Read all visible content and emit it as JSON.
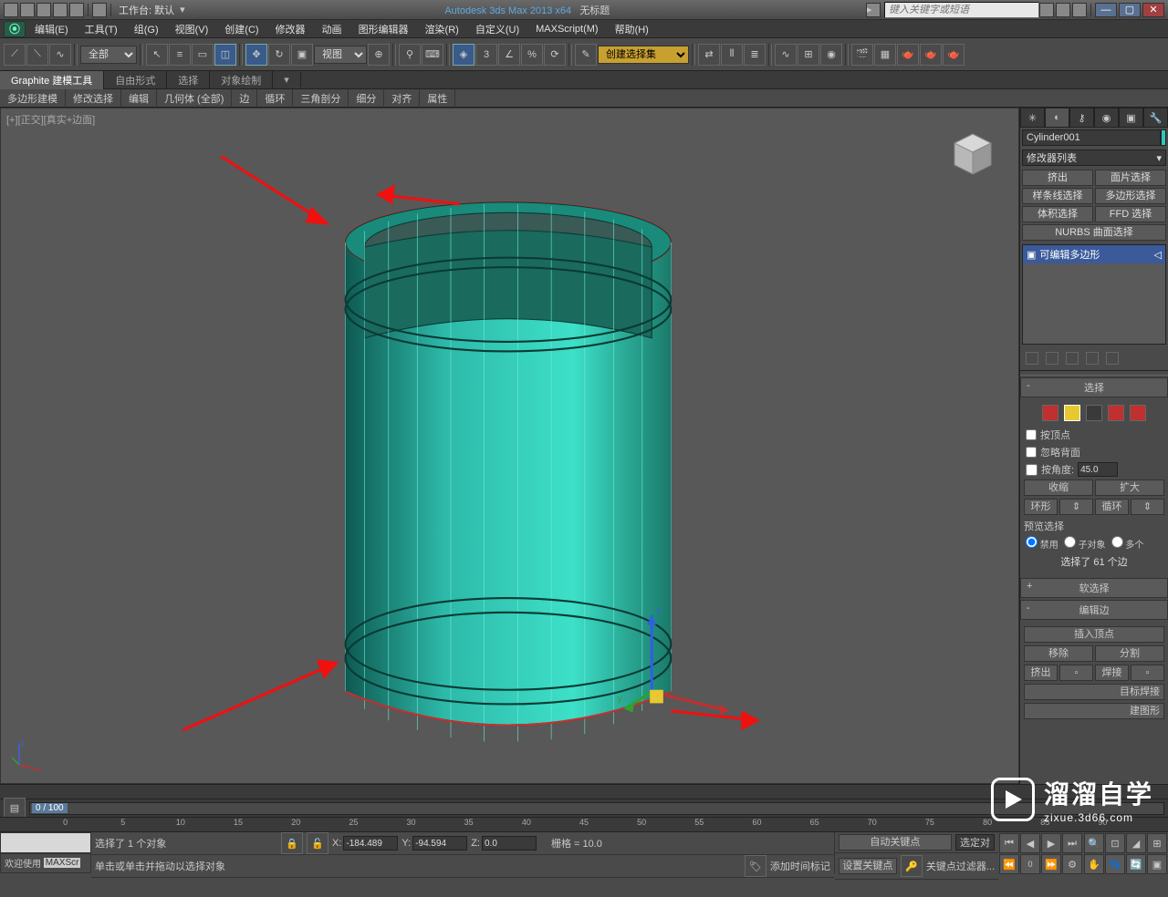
{
  "titlebar": {
    "workspace_label": "工作台: 默认",
    "app_name": "Autodesk 3ds Max  2013 x64",
    "doc_name": "无标题",
    "search_placeholder": "键入关键字或短语"
  },
  "menu": {
    "items": [
      "编辑(E)",
      "工具(T)",
      "组(G)",
      "视图(V)",
      "创建(C)",
      "修改器",
      "动画",
      "图形编辑器",
      "渲染(R)",
      "自定义(U)",
      "MAXScript(M)",
      "帮助(H)"
    ]
  },
  "toolbar": {
    "filter": "全部",
    "view_label": "视图",
    "create_set": "创建选择集"
  },
  "ribbon": {
    "tabs": [
      "Graphite 建模工具",
      "自由形式",
      "选择",
      "对象绘制"
    ]
  },
  "ribbon2": {
    "items": [
      "多边形建模",
      "修改选择",
      "编辑",
      "几何体 (全部)",
      "边",
      "循环",
      "三角剖分",
      "细分",
      "对齐",
      "属性"
    ]
  },
  "viewport": {
    "label": "[+][正交][真实+边面]"
  },
  "cmd": {
    "object_name": "Cylinder001",
    "modifier_list": "修改器列表",
    "btns": {
      "extrude": "挤出",
      "face_sel": "面片选择",
      "spline_sel": "样条线选择",
      "poly_sel": "多边形选择",
      "vol_sel": "体积选择",
      "ffd_sel": "FFD 选择",
      "nurbs": "NURBS 曲面选择"
    },
    "stack_item": "可编辑多边形",
    "rollouts": {
      "selection": "选择",
      "by_vertex": "按顶点",
      "ignore_back": "忽略背面",
      "by_angle": "按角度:",
      "angle_val": "45.0",
      "shrink": "收缩",
      "grow": "扩大",
      "ring": "环形",
      "loop": "循环",
      "preview": "预览选择",
      "disable": "禁用",
      "subobj": "子对象",
      "multi": "多个",
      "sel_status": "选择了 61 个边",
      "soft_sel": "软选择",
      "edit_edge": "编辑边",
      "insert_vert": "插入顶点",
      "remove": "移除",
      "split": "分割",
      "extrude2": "挤出",
      "weld": "焊接",
      "target_weld": "目标焊接",
      "edge_shape": "建图形"
    }
  },
  "timeline": {
    "pos": "0 / 100",
    "ticks": [
      "0",
      "5",
      "10",
      "15",
      "20",
      "25",
      "30",
      "35",
      "40",
      "45",
      "50",
      "55",
      "60",
      "65",
      "70",
      "75",
      "80",
      "85",
      "90"
    ]
  },
  "status": {
    "welcome": "欢迎使用",
    "maxscr": "MAXScr",
    "sel_info": "选择了 1 个对象",
    "hint": "单击或单击并拖动以选择对象",
    "x": "-184.489",
    "y": "-94.594",
    "z": "0.0",
    "grid": "栅格 = 10.0",
    "add_time": "添加时间标记",
    "auto_key": "自动关键点",
    "sel_lock": "选定对",
    "set_key": "设置关键点",
    "key_filter": "关键点过滤器..."
  },
  "watermark": {
    "text": "溜溜自学",
    "url": "zixue.3d66.com"
  }
}
